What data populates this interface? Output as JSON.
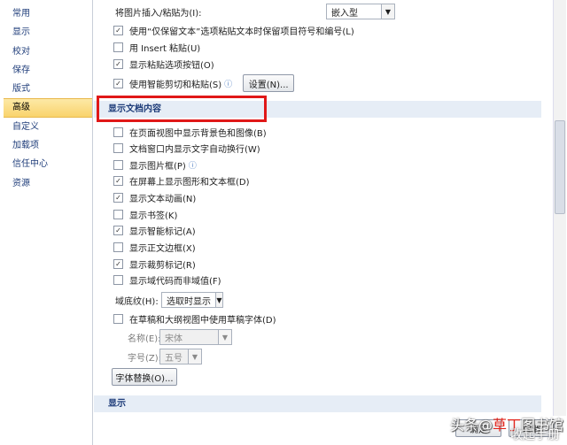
{
  "sidebar": {
    "items": [
      {
        "label": "常用"
      },
      {
        "label": "显示"
      },
      {
        "label": "校对"
      },
      {
        "label": "保存"
      },
      {
        "label": "版式"
      },
      {
        "label": "高级"
      },
      {
        "label": "自定义"
      },
      {
        "label": "加载项"
      },
      {
        "label": "信任中心"
      },
      {
        "label": "资源"
      }
    ],
    "active_index": 5
  },
  "cut_paste": {
    "insert_paste_label": "将图片插入/粘贴为(I):",
    "insert_paste_value": "嵌入型",
    "keep_bullets_label": "使用“仅保留文本”选项粘贴文本时保留项目符号和编号(L)",
    "insert_key_label": "用 Insert 粘贴(U)",
    "show_paste_options_label": "显示粘贴选项按钮(O)",
    "smart_cut_label": "使用智能剪切和粘贴(S)",
    "settings_button": "设置(N)..."
  },
  "show_doc_content": {
    "header": "显示文档内容",
    "options": [
      {
        "label": "在页面视图中显示背景色和图像(B)",
        "checked": false
      },
      {
        "label": "文档窗口内显示文字自动换行(W)",
        "checked": false
      },
      {
        "label": "显示图片框(P)",
        "checked": false,
        "info": true
      },
      {
        "label": "在屏幕上显示图形和文本框(D)",
        "checked": true
      },
      {
        "label": "显示文本动画(N)",
        "checked": true
      },
      {
        "label": "显示书签(K)",
        "checked": false
      },
      {
        "label": "显示智能标记(A)",
        "checked": true
      },
      {
        "label": "显示正文边框(X)",
        "checked": false
      },
      {
        "label": "显示裁剪标记(R)",
        "checked": true
      },
      {
        "label": "显示域代码而非域值(F)",
        "checked": false
      }
    ],
    "field_shading_label": "域底纹(H):",
    "field_shading_value": "选取时显示",
    "draft_font_label": "在草稿和大纲视图中使用草稿字体(D)",
    "font_name_label": "名称(E):",
    "font_name_value": "宋体",
    "font_size_label": "字号(Z):",
    "font_size_value": "五号",
    "font_sub_button": "字体替换(O)..."
  },
  "display_section": {
    "header": "显示"
  },
  "footer": {
    "ok_button": "确定",
    "cancel_button": "取消"
  },
  "watermark": {
    "part1": "头条",
    "part2": "@",
    "part3": "草丁",
    "part4": "图书馆",
    "part5": "收起手册"
  },
  "colors": {
    "section_header_bg": "#e6edf6",
    "highlight_box": "#e01818",
    "active_sidebar": "#f9d36c"
  }
}
